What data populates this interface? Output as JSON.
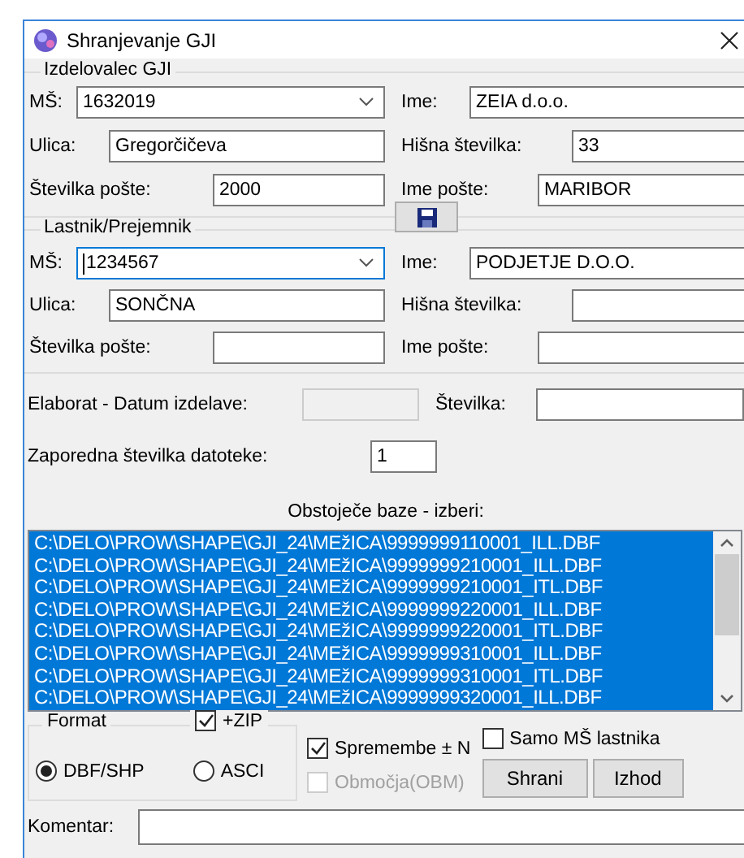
{
  "window": {
    "title": "Shranjevanje GJI"
  },
  "groups": [
    {
      "legend": "Izdelovalec GJI",
      "fields": [
        {
          "label": "MŠ:",
          "value": "1632019",
          "kind": "combo",
          "focused": false
        },
        {
          "label": "Ime:",
          "value": "ZEIA d.o.o.",
          "kind": "text"
        },
        {
          "label": "Ulica:",
          "value": "Gregorčičeva",
          "kind": "text"
        },
        {
          "label": "Hišna številka:",
          "value": "33",
          "kind": "text"
        },
        {
          "label": "Številka pošte:",
          "value": "2000",
          "kind": "text"
        },
        {
          "label": "Ime pošte:",
          "value": "MARIBOR",
          "kind": "text"
        }
      ]
    },
    {
      "legend": "Lastnik/Prejemnik",
      "fields": [
        {
          "label": "MŠ:",
          "value": "1234567",
          "kind": "combo",
          "focused": true
        },
        {
          "label": "Ime:",
          "value": "PODJETJE D.O.O.",
          "kind": "text"
        },
        {
          "label": "Ulica:",
          "value": "SONČNA",
          "kind": "text"
        },
        {
          "label": "Hišna številka:",
          "kind": "text"
        },
        {
          "label": "Številka pošte:",
          "kind": "text"
        },
        {
          "label": "Ime pošte:",
          "kind": "text"
        }
      ]
    }
  ],
  "elaborat": {
    "date_label": "Elaborat - Datum izdelave:",
    "date_disabled": true,
    "number_label": "Številka:"
  },
  "file_number": {
    "label": "Zaporedna številka datoteke:",
    "value": "1"
  },
  "databases": {
    "label": "Obstoječe baze - izberi:",
    "items": [
      {
        "text": "C:\\DELO\\PROW\\SHAPE\\GJI_24\\MEžICA\\9999999110001_ILL.DBF",
        "selected": true
      },
      {
        "text": "C:\\DELO\\PROW\\SHAPE\\GJI_24\\MEžICA\\9999999210001_ILL.DBF",
        "selected": true
      },
      {
        "text": "C:\\DELO\\PROW\\SHAPE\\GJI_24\\MEžICA\\9999999210001_ITL.DBF",
        "selected": true
      },
      {
        "text": "C:\\DELO\\PROW\\SHAPE\\GJI_24\\MEžICA\\9999999220001_ILL.DBF",
        "selected": true
      },
      {
        "text": "C:\\DELO\\PROW\\SHAPE\\GJI_24\\MEžICA\\9999999220001_ITL.DBF",
        "selected": true
      },
      {
        "text": "C:\\DELO\\PROW\\SHAPE\\GJI_24\\MEžICA\\9999999310001_ILL.DBF",
        "selected": true
      },
      {
        "text": "C:\\DELO\\PROW\\SHAPE\\GJI_24\\MEžICA\\9999999310001_ITL.DBF",
        "selected": true
      },
      {
        "text": "C:\\DELO\\PROW\\SHAPE\\GJI_24\\MEžICA\\9999999320001_ILL.DBF",
        "selected": true
      }
    ]
  },
  "format": {
    "legend": "Format",
    "zip": {
      "label": "+ZIP",
      "checked": true
    },
    "options": [
      {
        "label": "DBF/SHP",
        "selected": true
      },
      {
        "label": "ASCI",
        "selected": false
      }
    ]
  },
  "options": [
    {
      "label": "Spremembe ± N",
      "checked": true,
      "disabled": false
    },
    {
      "label": "Območja(OBM)",
      "checked": false,
      "disabled": true
    }
  ],
  "owner_only": {
    "label": "Samo MŠ lastnika",
    "checked": false
  },
  "buttons": [
    "Shrani",
    "Izhod"
  ],
  "comment": {
    "label": "Komentar:"
  }
}
